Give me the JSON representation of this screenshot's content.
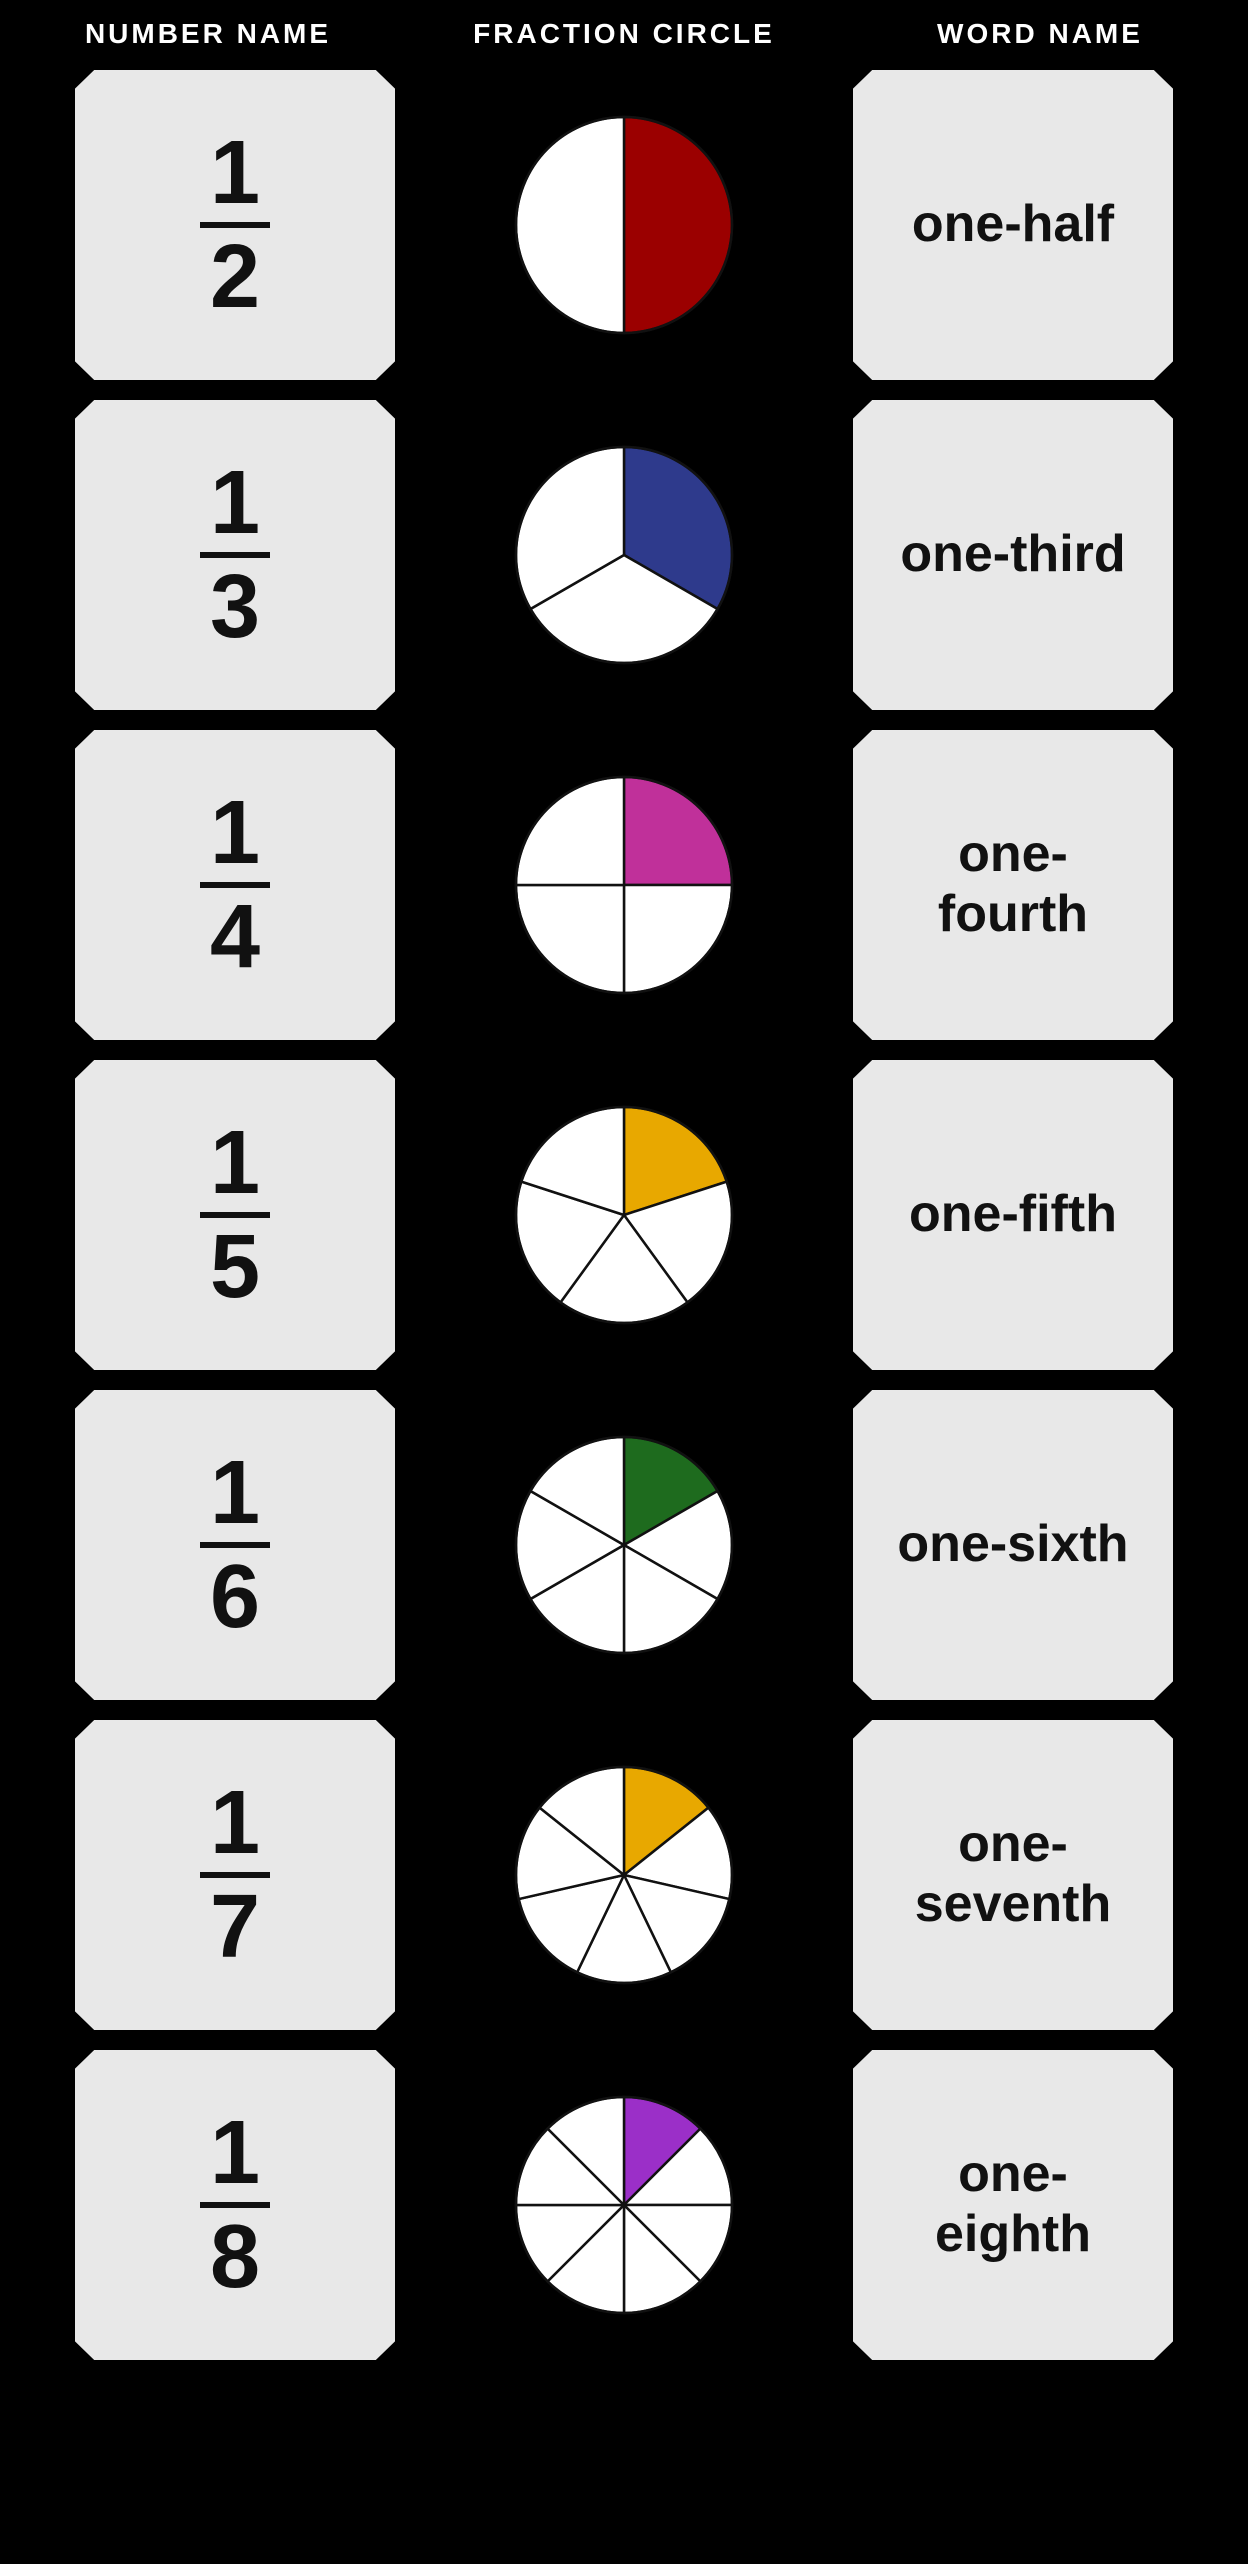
{
  "header": {
    "col1": "NUMBER NAME",
    "col2": "FRACTION CIRCLE",
    "col3": "WORD NAME"
  },
  "rows": [
    {
      "numerator": "1",
      "denominator": "2",
      "word": "one-half",
      "fraction": 0.5,
      "slices": 2,
      "color": "#9B0000"
    },
    {
      "numerator": "1",
      "denominator": "3",
      "word": "one-third",
      "fraction": 0.333,
      "slices": 3,
      "color": "#2E3A8C"
    },
    {
      "numerator": "1",
      "denominator": "4",
      "word": "one-\nfourth",
      "fraction": 0.25,
      "slices": 4,
      "color": "#C0309A"
    },
    {
      "numerator": "1",
      "denominator": "5",
      "word": "one-fifth",
      "fraction": 0.2,
      "slices": 5,
      "color": "#E8A800"
    },
    {
      "numerator": "1",
      "denominator": "6",
      "word": "one-sixth",
      "fraction": 0.1667,
      "slices": 6,
      "color": "#1E6B1E"
    },
    {
      "numerator": "1",
      "denominator": "7",
      "word": "one-\nseventh",
      "fraction": 0.1429,
      "slices": 7,
      "color": "#E8A800"
    },
    {
      "numerator": "1",
      "denominator": "8",
      "word": "one-\neighth",
      "fraction": 0.125,
      "slices": 8,
      "color": "#9B2FC8"
    }
  ]
}
